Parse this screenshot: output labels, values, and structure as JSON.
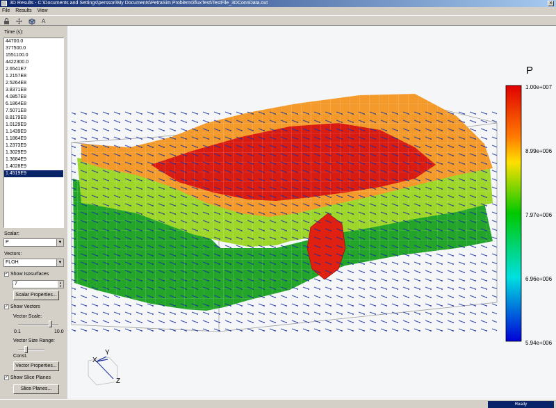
{
  "window": {
    "title": "3D Results - C:\\Documents and Settings\\persson\\My Documents\\PetraSim Problems\\fluxTest\\TestFile_3DConnData.out"
  },
  "menu": [
    "File",
    "Results",
    "View"
  ],
  "toolbar": {
    "icons": [
      "lock-icon",
      "pan-icon",
      "rotate-cube-icon",
      "text-a-icon"
    ]
  },
  "time": {
    "label": "Time (s):",
    "values": [
      "44700.0",
      "377500.0",
      "1551100.0",
      "4422300.0",
      "2.6541E7",
      "1.2157E8",
      "2.5264E8",
      "3.8371E8",
      "4.0857E8",
      "6.1864E8",
      "7.5071E8",
      "8.8179E8",
      "1.0129E9",
      "1.1439E9",
      "1.1864E9",
      "1.2373E9",
      "1.3029E9",
      "1.3684E9",
      "1.4028E9",
      "1.4519E9"
    ],
    "selected": "1.4519E9"
  },
  "scalar": {
    "label": "Scalar:",
    "value": "P"
  },
  "vectors": {
    "label": "Vectors:",
    "value": "FLOH"
  },
  "isosurfaces": {
    "label": "Show Isosurfaces",
    "checked": true,
    "count": "7",
    "button": "Scalar Properties..."
  },
  "show_vectors": {
    "label": "Show Vectors",
    "checked": true
  },
  "vector_scale": {
    "label": "Vector Scale:",
    "min": "0.1",
    "max": "10.0",
    "level": 0.8
  },
  "vector_size_range": {
    "label": "Vector Size Range:",
    "min": "Const.",
    "level": 0.3
  },
  "vector_properties_button": "Vector Properties...",
  "slice_planes": {
    "label": "Show Slice Planes",
    "checked": true,
    "button": "Slice Planes..."
  },
  "legend": {
    "title": "P",
    "ticks": [
      "1.00e+007",
      "8.99e+006",
      "7.97e+006",
      "6.96e+006",
      "5.94e+006"
    ]
  },
  "axes": {
    "x": "X",
    "y": "Y",
    "z": "Z"
  },
  "status": "Ready",
  "colors": {
    "titlebar": "#0a246a",
    "selection": "#0a246a",
    "background": "#d4d0c8",
    "viewport": "#f4f6f8"
  }
}
